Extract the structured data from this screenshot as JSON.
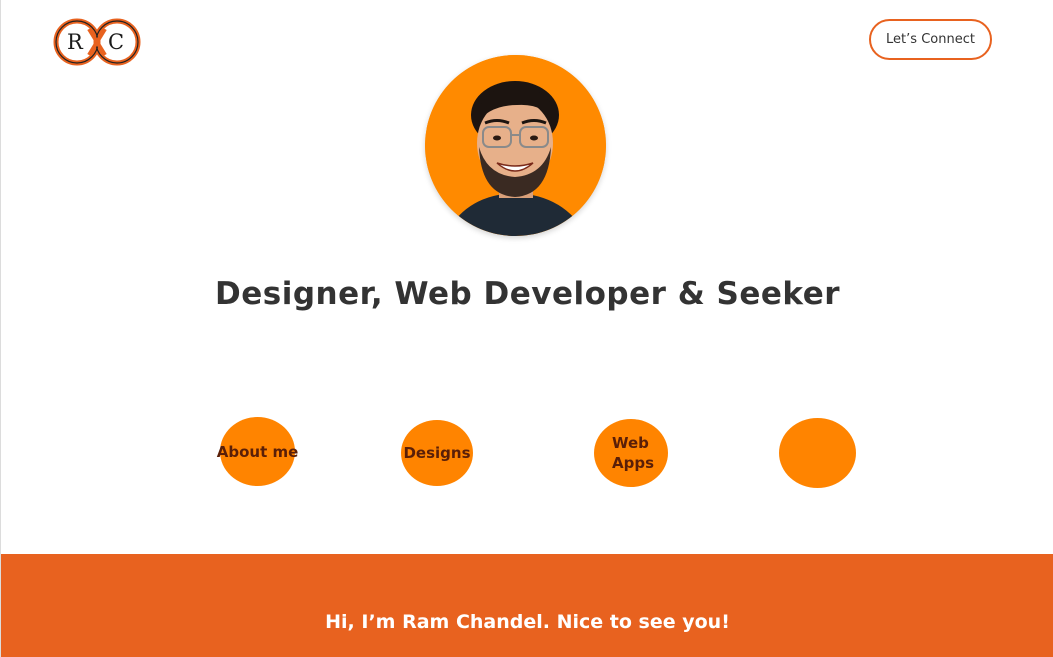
{
  "header": {
    "logo_letter_left": "R",
    "logo_letter_right": "C",
    "connect_label": "Let’s Connect"
  },
  "hero": {
    "headline": "Designer, Web Developer & Seeker"
  },
  "nav": {
    "about_label": "About me",
    "designs_label": "Designs",
    "web_line1": "Web",
    "web_line2": "Apps",
    "empty_label": ""
  },
  "footer": {
    "greeting": "Hi, I’m Ram Chandel. Nice to see you!"
  },
  "colors": {
    "accent": "#e8621f",
    "circle": "#ff8400",
    "avatar_bg": "#ff8a00",
    "text_dark": "#333333"
  }
}
